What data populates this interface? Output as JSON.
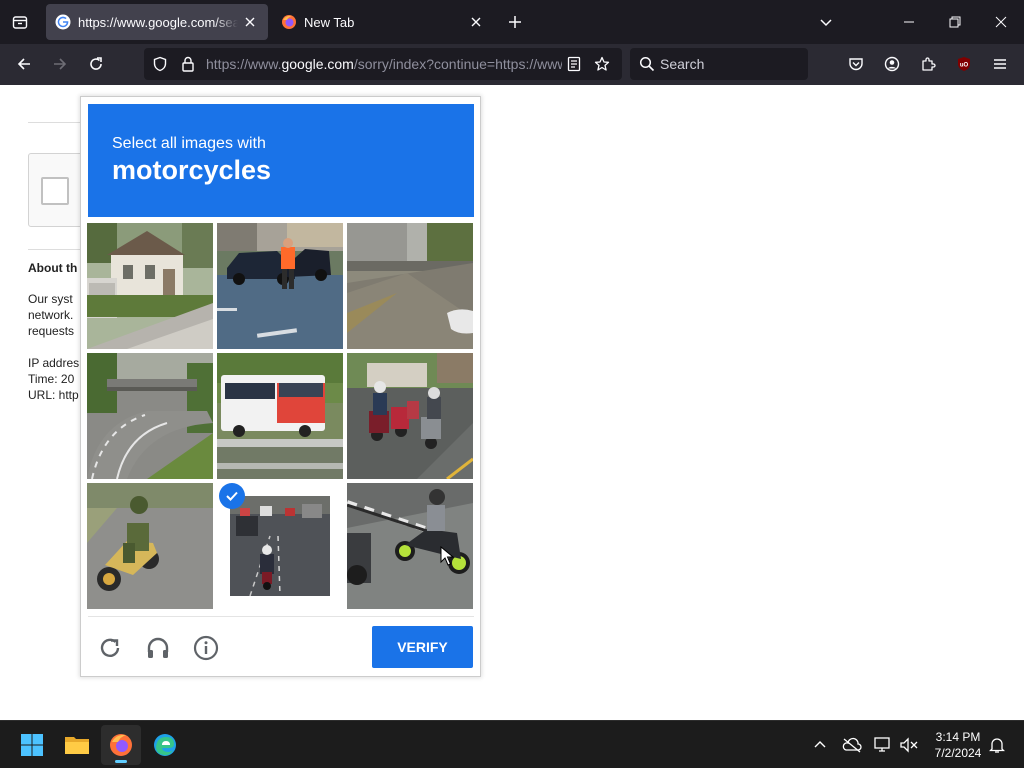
{
  "browser": {
    "tabs": [
      {
        "title": "https://www.google.com/search?",
        "favicon": "google-icon",
        "active": true
      },
      {
        "title": "New Tab",
        "favicon": "firefox-icon",
        "active": false
      }
    ],
    "url": {
      "prefix": "https://www.",
      "domain": "google.com",
      "rest": "/sorry/index?continue=https://www.google.com/search"
    },
    "search_placeholder": "Search"
  },
  "page_behind": {
    "heading": "About th",
    "para1": [
      "Our syst",
      "network.",
      "requests"
    ],
    "meta": [
      "IP addres",
      "Time: 20",
      "URL: http"
    ]
  },
  "captcha": {
    "prompt": "Select all images with",
    "target": "motorcycles",
    "verify_label": "VERIFY",
    "tiles": [
      {
        "scene": "house",
        "selected": false
      },
      {
        "scene": "car-worker",
        "selected": false
      },
      {
        "scene": "parking-lot",
        "selected": false
      },
      {
        "scene": "highway-curve",
        "selected": false
      },
      {
        "scene": "bus",
        "selected": false
      },
      {
        "scene": "scooters",
        "selected": false
      },
      {
        "scene": "motorcycle-rider",
        "selected": false
      },
      {
        "scene": "street-motorcycle",
        "selected": true
      },
      {
        "scene": "scooter-closeup",
        "selected": false
      }
    ]
  },
  "taskbar": {
    "time": "3:14 PM",
    "date": "7/2/2024"
  },
  "colors": {
    "accent": "#1a73e8",
    "tab_bg": "#1c1b22",
    "nav_bg": "#2b2a33",
    "taskbar_bg": "#1c1c1c"
  }
}
